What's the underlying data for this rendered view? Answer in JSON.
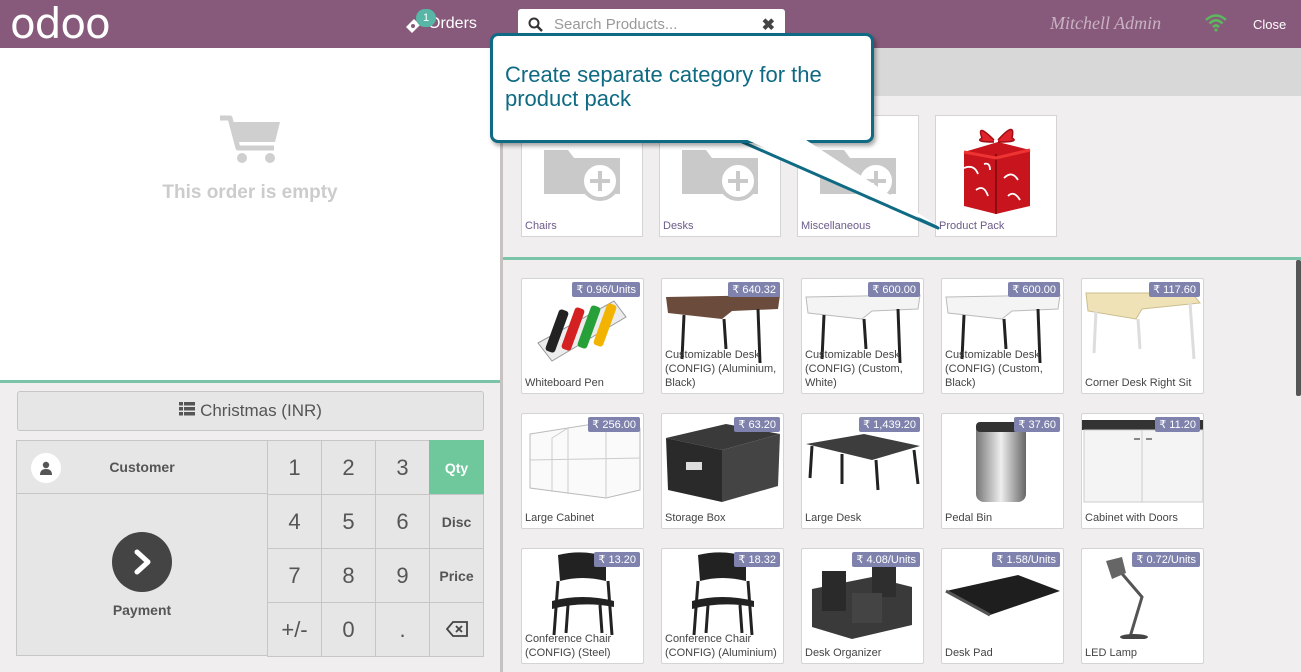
{
  "header": {
    "logo": "odoo",
    "orders_label": "Orders",
    "orders_count": "1",
    "search_placeholder": "Search Products...",
    "search_clear": "✖",
    "username": "Mitchell Admin",
    "close_label": "Close"
  },
  "order": {
    "empty_text": "This order is empty"
  },
  "controls": {
    "pricelist_label": "Christmas (INR)",
    "customer_label": "Customer",
    "payment_label": "Payment",
    "keys": [
      "1",
      "2",
      "3",
      "Qty",
      "4",
      "5",
      "6",
      "Disc",
      "7",
      "8",
      "9",
      "Price",
      "+/-",
      "0",
      "."
    ],
    "active_mode": "Qty"
  },
  "categories": [
    {
      "name": "Chairs"
    },
    {
      "name": "Desks"
    },
    {
      "name": "Miscellaneous"
    },
    {
      "name": "Product Pack"
    }
  ],
  "products": [
    {
      "name": "Whiteboard Pen",
      "price": "₹ 0.96/Units"
    },
    {
      "name": "Customizable Desk (CONFIG) (Aluminium, Black)",
      "price": "₹ 640.32"
    },
    {
      "name": "Customizable Desk (CONFIG) (Custom, White)",
      "price": "₹ 600.00"
    },
    {
      "name": "Customizable Desk (CONFIG) (Custom, Black)",
      "price": "₹ 600.00"
    },
    {
      "name": "Corner Desk Right Sit",
      "price": "₹ 117.60"
    },
    {
      "name": "Large Cabinet",
      "price": "₹ 256.00"
    },
    {
      "name": "Storage Box",
      "price": "₹ 63.20"
    },
    {
      "name": "Large Desk",
      "price": "₹ 1,439.20"
    },
    {
      "name": "Pedal Bin",
      "price": "₹ 37.60"
    },
    {
      "name": "Cabinet with Doors",
      "price": "₹ 11.20"
    },
    {
      "name": "Conference Chair (CONFIG) (Steel)",
      "price": "₹ 13.20"
    },
    {
      "name": "Conference Chair (CONFIG) (Aluminium)",
      "price": "₹ 18.32"
    },
    {
      "name": "Desk Organizer",
      "price": "₹ 4.08/Units"
    },
    {
      "name": "Desk Pad",
      "price": "₹ 1.58/Units"
    },
    {
      "name": "LED Lamp",
      "price": "₹ 0.72/Units"
    }
  ],
  "tooltip": {
    "text": "Create separate category for the product pack"
  },
  "colors": {
    "header": "#875a7b",
    "accent": "#6ec89b",
    "price_tag": "#7f82ac",
    "tooltip": "#0f6a83"
  }
}
